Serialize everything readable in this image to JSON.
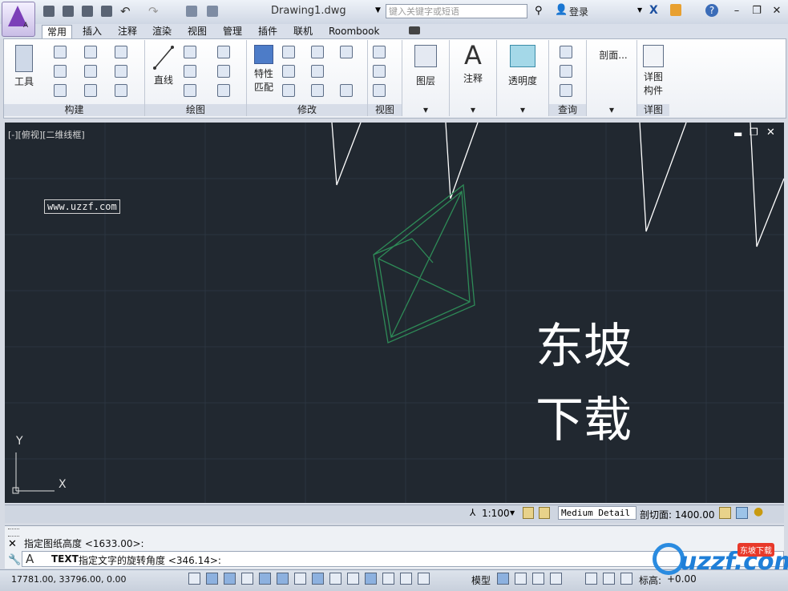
{
  "titlebar": {
    "document_title": "Drawing1.dwg",
    "search_placeholder": "键入关键字或短语",
    "login_label": "登录",
    "help_label": "?"
  },
  "tabs": [
    {
      "label": "常用",
      "active": true
    },
    {
      "label": "插入"
    },
    {
      "label": "注释"
    },
    {
      "label": "渲染"
    },
    {
      "label": "视图"
    },
    {
      "label": "管理"
    },
    {
      "label": "插件"
    },
    {
      "label": "联机"
    },
    {
      "label": "Roombook"
    }
  ],
  "ribbon": {
    "panels": {
      "build": {
        "title": "构建",
        "tool_label": "工具"
      },
      "draw": {
        "title": "绘图",
        "line_label": "直线"
      },
      "modify": {
        "title": "修改",
        "match_label_1": "特性",
        "match_label_2": "匹配"
      },
      "view": {
        "title": "视图"
      },
      "layers": {
        "label": "图层"
      },
      "annotate": {
        "label": "注释"
      },
      "transparency": {
        "label": "透明度"
      },
      "query": {
        "title": "查询"
      },
      "section": {
        "label": "剖面..."
      },
      "detail": {
        "title": "详图",
        "label_1": "详图",
        "label_2": "构件"
      }
    }
  },
  "viewport": {
    "label": "[-][俯视][二维线框]",
    "url_text": "www.uzzf.com",
    "big_text_line1": "东坡",
    "big_text_line2": "下载",
    "axis_y": "Y",
    "axis_x": "X"
  },
  "viewport_status": {
    "scale": "1:100",
    "detail_level": "Medium Detail",
    "section_label": "剖切面: 1400.00"
  },
  "command": {
    "history_line": "指定图纸高度 <1633.00>:",
    "prompt_cmd": "TEXT",
    "prompt_text": "指定文字的旋转角度 <346.14>:"
  },
  "statusbar": {
    "coords": "17781.00, 33796.00, 0.00",
    "model_label": "模型",
    "annotation_label": "标高:",
    "elevation_value": "+0.00"
  },
  "watermark": {
    "text": "uzzf.com",
    "badge": "东坡下载"
  },
  "colors": {
    "viewport_bg": "#212830",
    "shape_green": "#2e8b57",
    "lines_white": "#ffffff",
    "accent_purple": "#7b3fb8"
  }
}
